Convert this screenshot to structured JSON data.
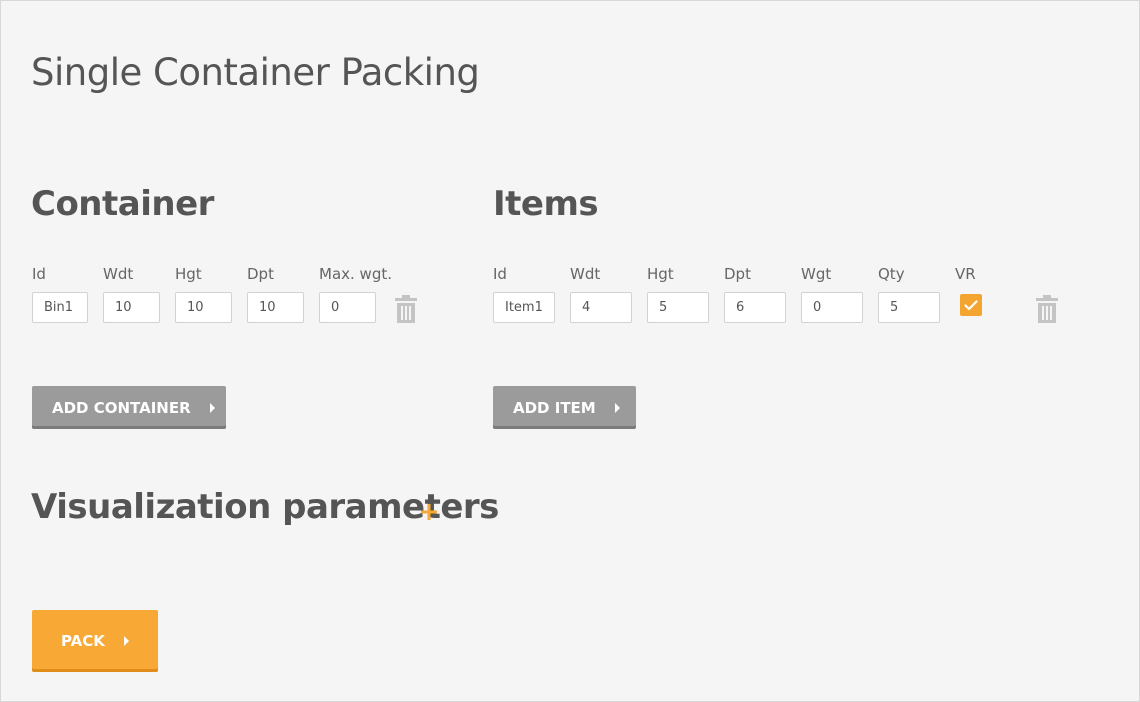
{
  "page": {
    "title": "Single Container Packing"
  },
  "container": {
    "title": "Container",
    "labels": {
      "id": "Id",
      "wdt": "Wdt",
      "hgt": "Hgt",
      "dpt": "Dpt",
      "max_wgt": "Max. wgt."
    },
    "rows": [
      {
        "id": "Bin1",
        "wdt": "10",
        "hgt": "10",
        "dpt": "10",
        "max_wgt": "0"
      }
    ],
    "add_button": "ADD CONTAINER"
  },
  "items": {
    "title": "Items",
    "labels": {
      "id": "Id",
      "wdt": "Wdt",
      "hgt": "Hgt",
      "dpt": "Dpt",
      "wgt": "Wgt",
      "qty": "Qty",
      "vr": "VR"
    },
    "rows": [
      {
        "id": "Item1",
        "wdt": "4",
        "hgt": "5",
        "dpt": "6",
        "wgt": "0",
        "qty": "5",
        "vr": true
      }
    ],
    "add_button": "ADD ITEM"
  },
  "visualization": {
    "title": "Visualization parameters",
    "expand_icon": "plus-icon"
  },
  "pack_button": "PACK",
  "colors": {
    "accent": "#f8a935",
    "button_gray": "#9b9b9b",
    "text": "#555555"
  }
}
